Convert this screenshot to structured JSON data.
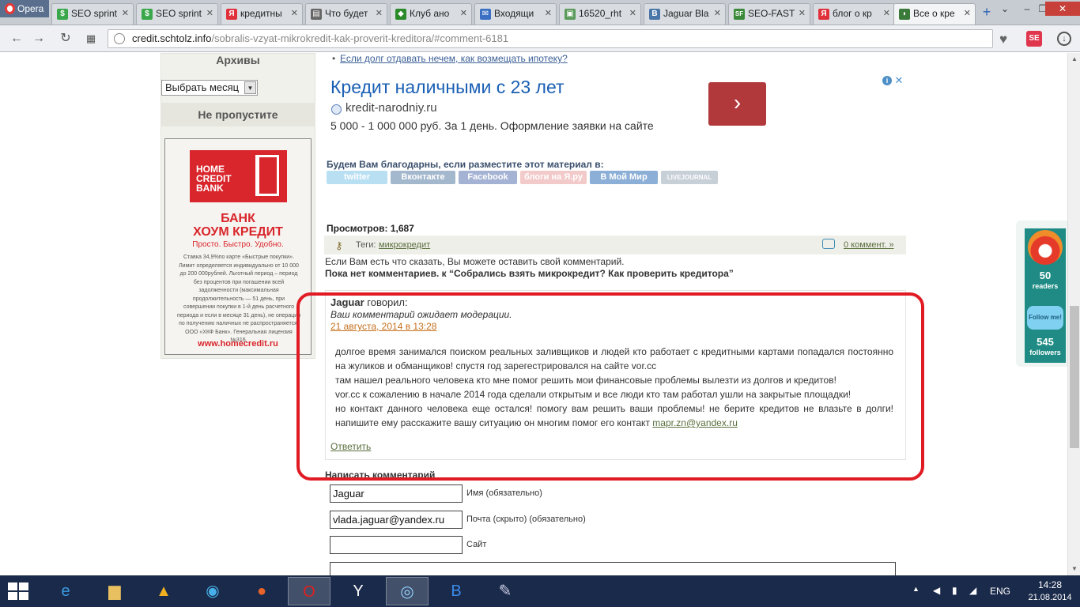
{
  "browser": {
    "menu_label": "Opera",
    "tabs": [
      {
        "label": "SEO sprint",
        "favicon": "$",
        "color": "#3aa84a"
      },
      {
        "label": "SEO sprint",
        "favicon": "$",
        "color": "#3aa84a"
      },
      {
        "label": "кредитны",
        "favicon": "Я",
        "color": "#e0313b"
      },
      {
        "label": "Что будет",
        "favicon": "▤",
        "color": "#666666"
      },
      {
        "label": "Клуб ано",
        "favicon": "◆",
        "color": "#2a8a2a"
      },
      {
        "label": "Входящи",
        "favicon": "✉",
        "color": "#3b6fc4"
      },
      {
        "label": "16520_rht",
        "favicon": "▣",
        "color": "#5a9a5a"
      },
      {
        "label": "Jaguar Bla",
        "favicon": "В",
        "color": "#4a76a8"
      },
      {
        "label": "SEO-FAST",
        "favicon": "SF",
        "color": "#3a8a3a"
      },
      {
        "label": "блог о кр",
        "favicon": "Я",
        "color": "#e0313b"
      },
      {
        "label": "Все о кре",
        "favicon": "◗",
        "color": "#3a7a3a"
      }
    ],
    "url_domain": "credit.schtolz.info",
    "url_path": "/sobralis-vzyat-mikrokredit-kak-proverit-kreditora/#comment-6181",
    "se_label": "SE"
  },
  "sidebar": {
    "archives_title": "Архивы",
    "month_select": "Выбрать месяц",
    "dont_miss_title": "Не пропустите",
    "banner": {
      "logo_lines": [
        "HOME",
        "CREDIT",
        "BANK"
      ],
      "headline_1": "БАНК",
      "headline_2": "ХОУМ КРЕДИТ",
      "slogan": "Просто. Быстро. Удобно.",
      "fine_print": "Ставка 34,9%по карте «Быстрые покупки». Лимит определяется индивидуально от 10 000 до 200 000рублей. Льготный период – период без процентов при погашении всей задолженности (максимальная продолжительность — 51 день, при совершении покупки в 1-й день расчетного периода и если в месяце 31 день), не операции по получению наличных не распространяется. ООО «ХКФ Банк». Генеральная лицензия №316.",
      "url": "www.homecredit.ru"
    }
  },
  "main": {
    "prev_link": "Если долг отдавать нечем, как возмещать ипотеку?",
    "ad": {
      "title": "Кредит наличными с 23 лет",
      "domain": "kredit-narodniy.ru",
      "description": "5 000 - 1 000 000 руб. За 1 день. Оформление заявки на сайте",
      "go_label": "›",
      "close_label": "✕"
    },
    "share_title": "Будем Вам благодарны, если разместите этот материал в:",
    "share_buttons": [
      {
        "label": "twitter",
        "color": "#7fc6e8"
      },
      {
        "label": "Вконтакте",
        "color": "#5b7fa6"
      },
      {
        "label": "Facebook",
        "color": "#5a74b0"
      },
      {
        "label": "блоги на Я.ру",
        "color": "#e8a0a0"
      },
      {
        "label": "В Мой Мир",
        "color": "#2d6fb5"
      },
      {
        "label": "LIVEJOURNAL",
        "color": "#9aa8b8"
      }
    ],
    "views_label": "Просмотров:",
    "views_count": "1,687",
    "tags_label": "Теги:",
    "tag": "микрокредит",
    "comments_count_link": "0 коммент. »",
    "say_text": "Если Вам есть что сказать, Вы можете оставить свой комментарий.",
    "no_comments": "Пока нет комментариев. к “Собрались взять микрокредит? Как проверить кредитора”",
    "comment": {
      "author": "Jaguar",
      "said": "говорил:",
      "moderation": "Ваш комментарий ожидает модерации.",
      "date": "21 августа, 2014 в 13:28",
      "lines": [
        "долгое время занимался поиском реальных заливщиков и людей кто работает с кредитными картами попадался постоянно на жуликов и обманщиков! спустя год зарегестрировался на сайте vor.cc",
        "там нашел реального человека кто мне помог решить мои финансовые проблемы вылезти из долгов и кредитов!",
        "vor.cc к сожалению в начале 2014 года сделали открытым и все люди кто там работал ушли на закрытые площадки!",
        "но контакт данного человека еще остался! помогу вам решить ваши проблемы! не берите кредитов не влазьте в долги! напишите ему расскажите вашу ситуацию он многим помог его контакт"
      ],
      "email": "mapr.zn@yandex.ru",
      "reply": "Ответить"
    },
    "form": {
      "title": "Написать комментарий",
      "name_value": "Jaguar",
      "name_label": "Имя (обязательно)",
      "email_value": "vlada.jaguar@yandex.ru",
      "email_label": "Почта (скрыто) (обязательно)",
      "site_value": "",
      "site_label": "Сайт"
    }
  },
  "widget": {
    "readers_count": "50",
    "readers_label": "readers",
    "follow_label": "Follow me!",
    "followers_count": "545",
    "followers_label": "followers"
  },
  "taskbar": {
    "lang": "ENG",
    "time": "14:28",
    "date": "21.08.2014"
  },
  "colors": {
    "highlight": "#e01b24",
    "ad_title": "#1a5fb4",
    "ad_button": "#b1383b",
    "homecredit_red": "#d9262c",
    "date_link": "#c5701d"
  }
}
